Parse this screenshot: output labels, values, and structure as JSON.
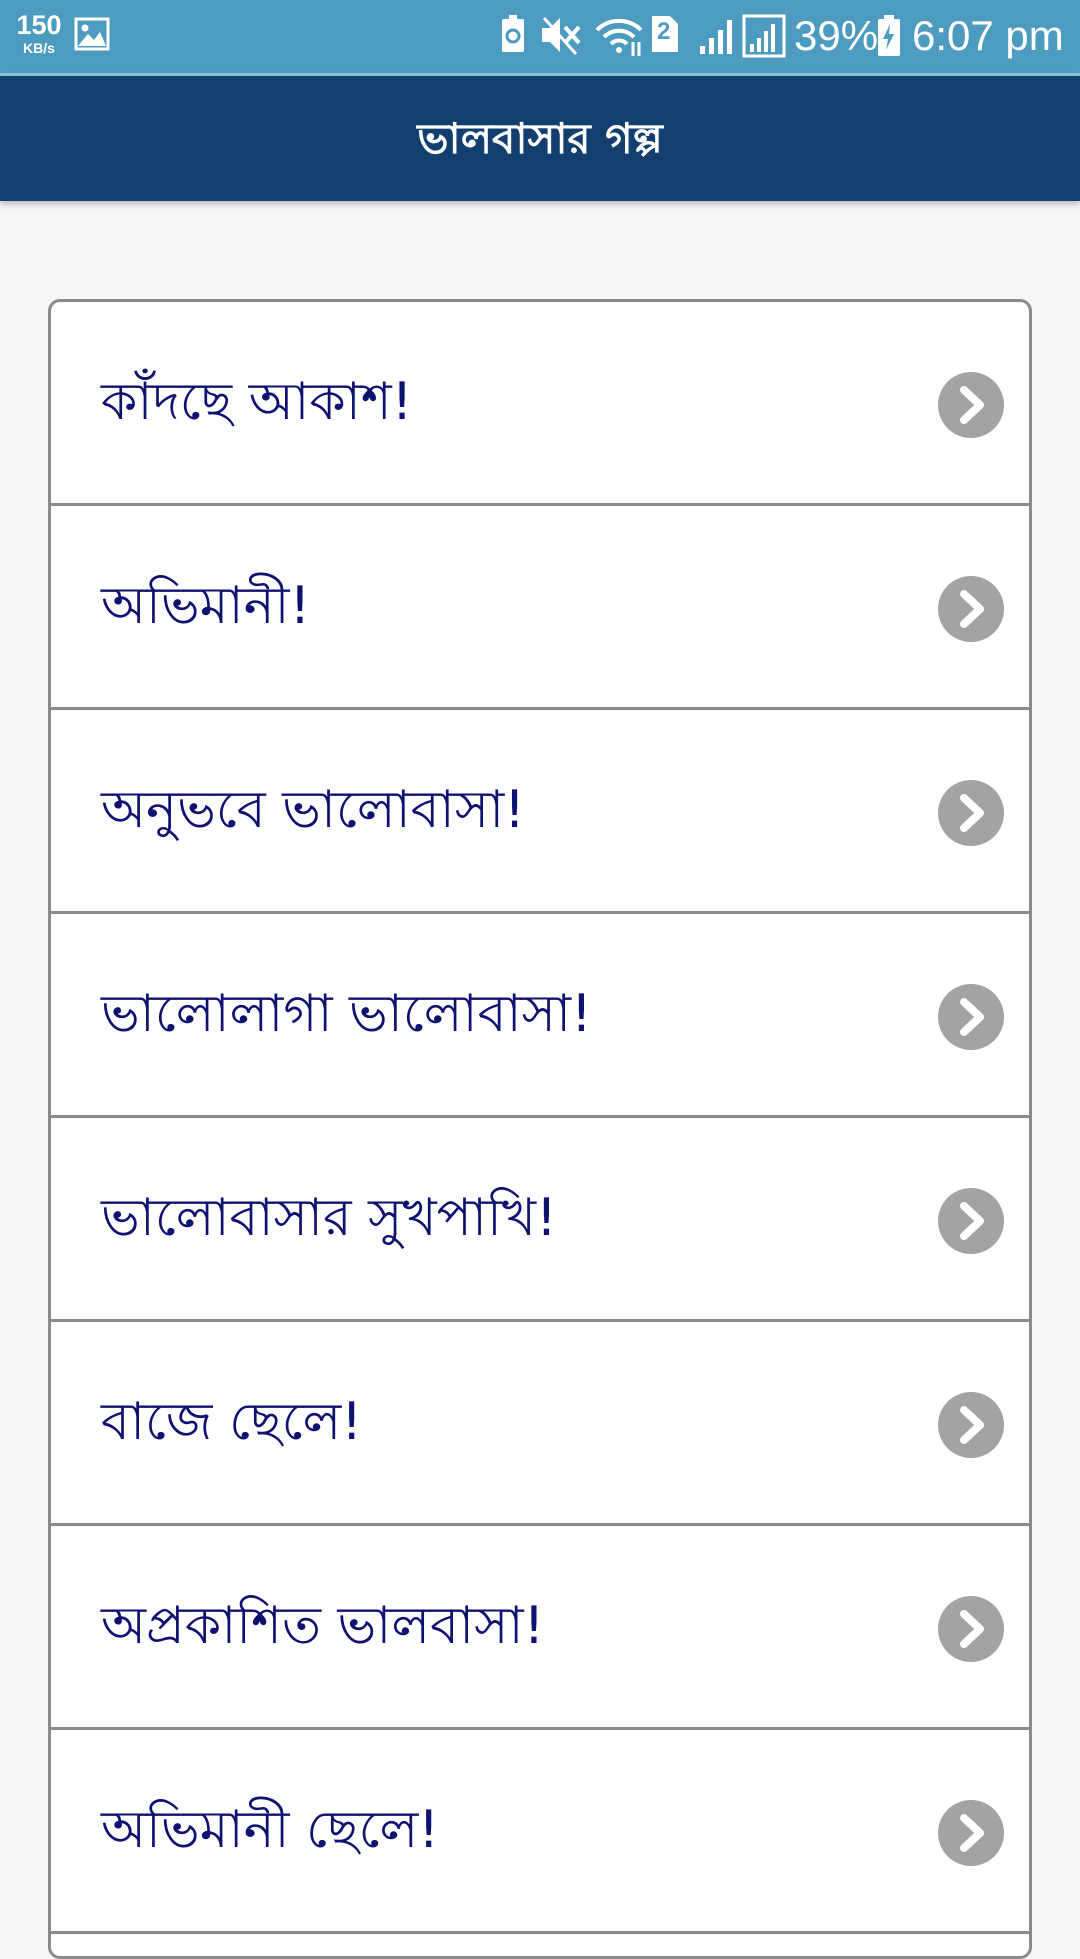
{
  "status_bar": {
    "net_speed_value": "150",
    "net_speed_unit": "KB/s",
    "sim_slot": "2",
    "battery_percent": "39%",
    "time": "6:07 pm"
  },
  "app_bar": {
    "title": "ভালবাসার গল্প"
  },
  "stories": [
    {
      "title": "কাঁদছে আকাশ!"
    },
    {
      "title": "অভিমানী!"
    },
    {
      "title": "অনুভবে ভালোবাসা!"
    },
    {
      "title": "ভালোলাগা ভালোবাসা!"
    },
    {
      "title": "ভালোবাসার সুখপাখি!"
    },
    {
      "title": "বাজে ছেলে!"
    },
    {
      "title": "অপ্রকাশিত ভালবাসা!"
    },
    {
      "title": "অভিমানী ছেলে!"
    }
  ],
  "colors": {
    "status_bar": "#4d9cbf",
    "app_bar": "#123f6e",
    "item_text": "#0d1170",
    "chevron_circle": "#a3a3a3",
    "background": "#f6f6f6"
  },
  "icons": {
    "gallery": "image-icon",
    "recycle": "battery-saver-icon",
    "mute": "vibrate-mute-icon",
    "wifi": "wifi-icon",
    "sim": "sim-icon",
    "signal1": "signal-icon",
    "signal2": "signal-icon",
    "battery": "battery-icon",
    "chevron": "chevron-right-icon"
  }
}
